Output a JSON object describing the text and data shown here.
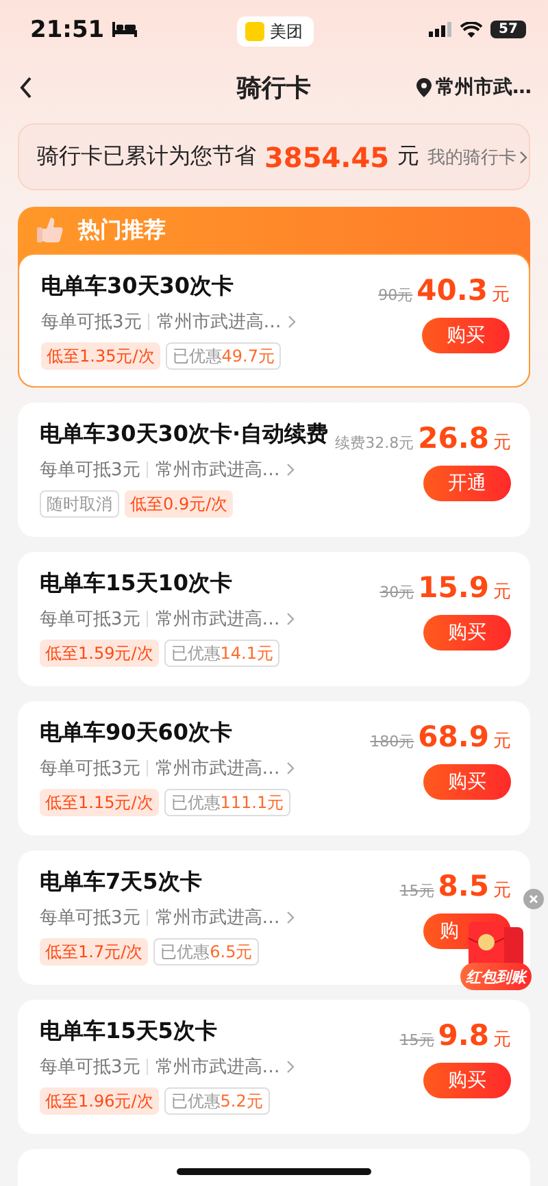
{
  "status_bar": {
    "time": "21:51",
    "app": "美团",
    "battery": "57"
  },
  "header": {
    "title": "骑行卡",
    "location": "常州市武…"
  },
  "savings": {
    "label": "骑行卡已累计为您节省",
    "amount": "3854.45",
    "unit": "元",
    "link": "我的骑行卡"
  },
  "featured": {
    "title": "热门推荐",
    "card": {
      "title": "电单车30天30次卡",
      "per_use": "每单可抵3元",
      "location": "常州市武进高…",
      "tags": [
        {
          "kind": "low",
          "label": "低至1.35元/次"
        },
        {
          "kind": "saved",
          "label": "已优惠",
          "amount": "49.7元"
        }
      ],
      "original_price": {
        "text": "90元",
        "struck": true
      },
      "price": "40.3",
      "unit": "元",
      "button": "购买",
      "highlighted": true
    }
  },
  "cards": [
    {
      "title": "电单车30天30次卡·自动续费",
      "per_use": "每单可抵3元",
      "location": "常州市武进高…",
      "tags": [
        {
          "kind": "plain",
          "label": "随时取消"
        },
        {
          "kind": "low",
          "label": "低至0.9元/次"
        }
      ],
      "original_price": {
        "text": "续费32.8元",
        "struck": false
      },
      "price": "26.8",
      "unit": "元",
      "button": "开通",
      "highlighted": false
    },
    {
      "title": "电单车15天10次卡",
      "per_use": "每单可抵3元",
      "location": "常州市武进高…",
      "tags": [
        {
          "kind": "low",
          "label": "低至1.59元/次"
        },
        {
          "kind": "saved",
          "label": "已优惠",
          "amount": "14.1元"
        }
      ],
      "original_price": {
        "text": "30元",
        "struck": true
      },
      "price": "15.9",
      "unit": "元",
      "button": "购买",
      "highlighted": false
    },
    {
      "title": "电单车90天60次卡",
      "per_use": "每单可抵3元",
      "location": "常州市武进高…",
      "tags": [
        {
          "kind": "low",
          "label": "低至1.15元/次"
        },
        {
          "kind": "saved",
          "label": "已优惠",
          "amount": "111.1元"
        }
      ],
      "original_price": {
        "text": "180元",
        "struck": true
      },
      "price": "68.9",
      "unit": "元",
      "button": "购买",
      "highlighted": false
    },
    {
      "title": "电单车7天5次卡",
      "per_use": "每单可抵3元",
      "location": "常州市武进高…",
      "tags": [
        {
          "kind": "low",
          "label": "低至1.7元/次"
        },
        {
          "kind": "saved",
          "label": "已优惠",
          "amount": "6.5元"
        }
      ],
      "original_price": {
        "text": "15元",
        "struck": true
      },
      "price": "8.5",
      "unit": "元",
      "button": "购",
      "highlighted": false,
      "promo": {
        "label": "红包到账"
      }
    },
    {
      "title": "电单车15天5次卡",
      "per_use": "每单可抵3元",
      "location": "常州市武进高…",
      "tags": [
        {
          "kind": "low",
          "label": "低至1.96元/次"
        },
        {
          "kind": "saved",
          "label": "已优惠",
          "amount": "5.2元"
        }
      ],
      "original_price": {
        "text": "15元",
        "struck": true
      },
      "price": "9.8",
      "unit": "元",
      "button": "购买",
      "highlighted": false
    }
  ]
}
